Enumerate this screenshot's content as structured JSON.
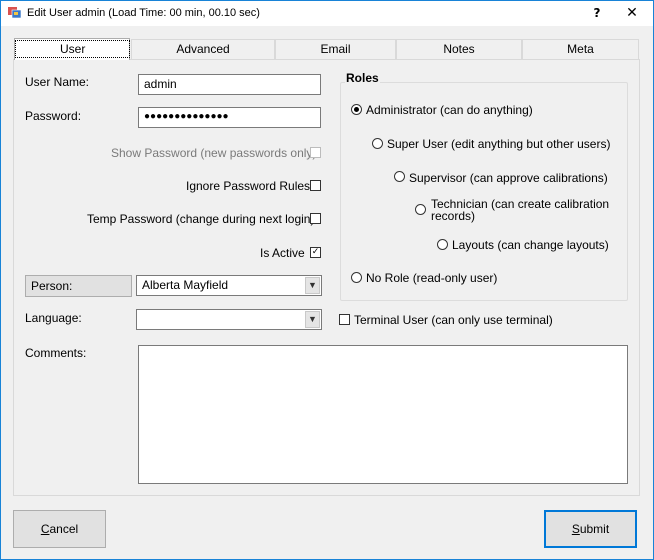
{
  "window": {
    "title": "Edit User admin (Load Time: 00 min, 00.10 sec)",
    "help_label": "?",
    "close_label": "✕"
  },
  "tabs": [
    {
      "label": "User",
      "active": true
    },
    {
      "label": "Advanced",
      "active": false
    },
    {
      "label": "Email",
      "active": false
    },
    {
      "label": "Notes",
      "active": false
    },
    {
      "label": "Meta",
      "active": false
    }
  ],
  "form": {
    "username_label": "User Name:",
    "username_value": "admin",
    "password_label": "Password:",
    "password_value": "●●●●●●●●●●●●●●",
    "show_password_label": "Show Password (new passwords only)",
    "show_password_checked": false,
    "ignore_rules_label": "Ignore Password Rules",
    "ignore_rules_checked": false,
    "temp_password_label": "Temp Password (change during next login)",
    "temp_password_checked": false,
    "is_active_label": "Is Active",
    "is_active_checked": true,
    "is_active_mark": "✓",
    "person_label": "Person:",
    "person_value": "Alberta Mayfield",
    "language_label": "Language:",
    "language_value": "",
    "comments_label": "Comments:",
    "comments_value": "",
    "terminal_user_label": "Terminal User (can only use terminal)",
    "terminal_user_checked": false,
    "dropdown_arrow": "▼"
  },
  "roles": {
    "title": "Roles",
    "options": [
      {
        "label": "Administrator (can do anything)",
        "selected": true
      },
      {
        "label": "Super User (edit anything but other users)",
        "selected": false
      },
      {
        "label": "Supervisor (can approve calibrations)",
        "selected": false
      },
      {
        "label": "Technician (can create calibration",
        "label2": "records)",
        "selected": false
      },
      {
        "label": "Layouts (can change layouts)",
        "selected": false
      },
      {
        "label": "No Role (read-only user)",
        "selected": false
      }
    ]
  },
  "buttons": {
    "cancel_mnemonic": "C",
    "cancel_rest": "ancel",
    "submit_mnemonic": "S",
    "submit_rest": "ubmit"
  },
  "colors": {
    "accent": "#0078d7",
    "window_border": "#1883d7",
    "background": "#f0f0f0"
  }
}
